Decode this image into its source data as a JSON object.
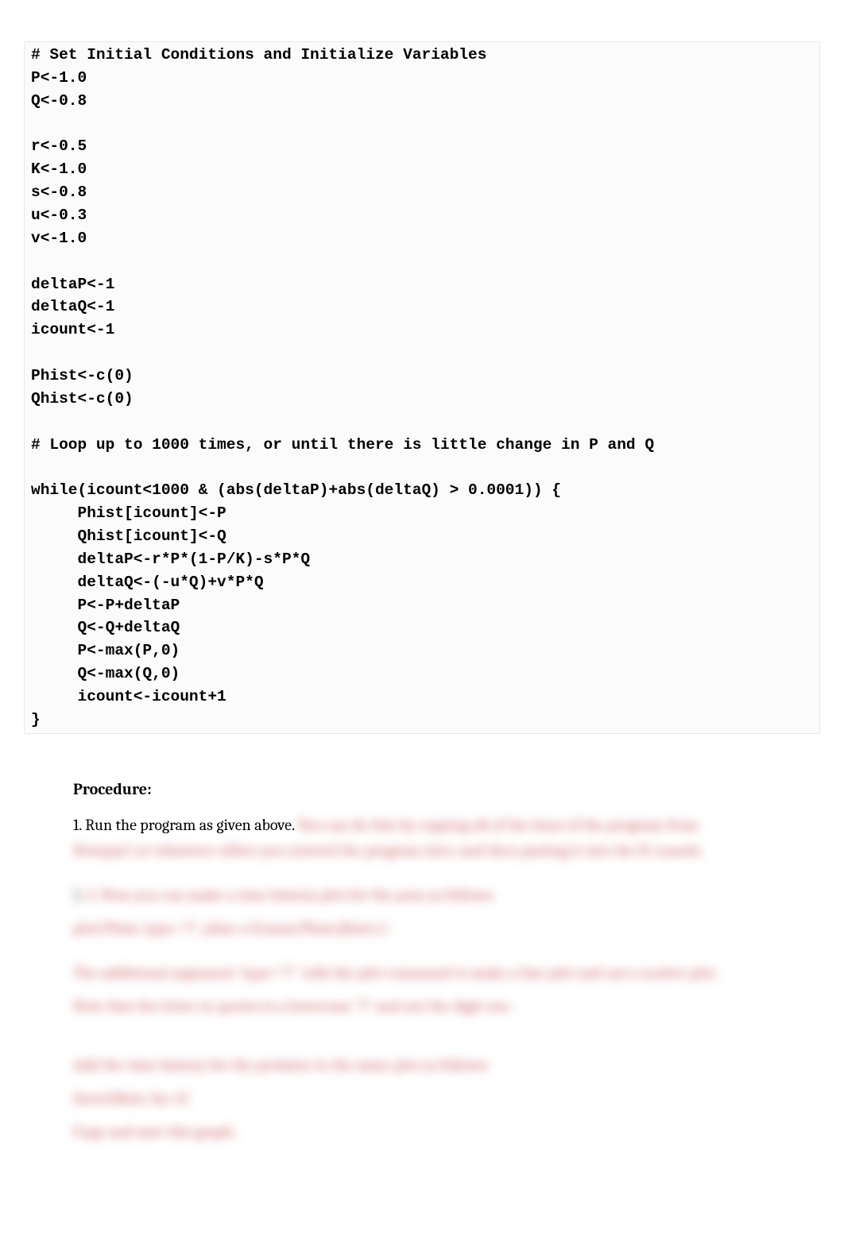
{
  "code": "# Set Initial Conditions and Initialize Variables\nP<-1.0\nQ<-0.8\n\nr<-0.5\nK<-1.0\ns<-0.8\nu<-0.3\nv<-1.0\n\ndeltaP<-1\ndeltaQ<-1\nicount<-1\n\nPhist<-c(0)\nQhist<-c(0)\n\n# Loop up to 1000 times, or until there is little change in P and Q\n\nwhile(icount<1000 & (abs(deltaP)+abs(deltaQ) > 0.0001)) {\n     Phist[icount]<-P\n     Qhist[icount]<-Q\n     deltaP<-r*P*(1-P/K)-s*P*Q\n     deltaQ<-(-u*Q)+v*P*Q\n     P<-P+deltaP\n     Q<-Q+deltaQ\n     P<-max(P,0)\n     Q<-max(Q,0)\n     icount<-icount+1\n}",
  "procedure_heading": "Procedure:",
  "step1_visible": "1. Run the program as given above. ",
  "blurred": {
    "line1_tail": "You can do this by copying all of the lines of the program from",
    "line2": "Notepad (or whatever editor you entered the program into) and then pasting it into the R console.",
    "line3": "2.  Now you can make a time history plot for the prey as follows:",
    "line4": "plot(Phist, type=\"l\", ylim=c(0,max(Phist,Qhist)))",
    "line5": "The additional argument 'type=\"l\"' tells the plot command to make a line plot and not a scatter plot.",
    "line6": "Note that the letter in quotes is a lowercase \"l\" and not the digit one.",
    "line7": "Add the time history for the predator to the same plot as follows:",
    "line8": "lines(Qhist, lty=2)",
    "line9": "Copy and save this graph."
  }
}
